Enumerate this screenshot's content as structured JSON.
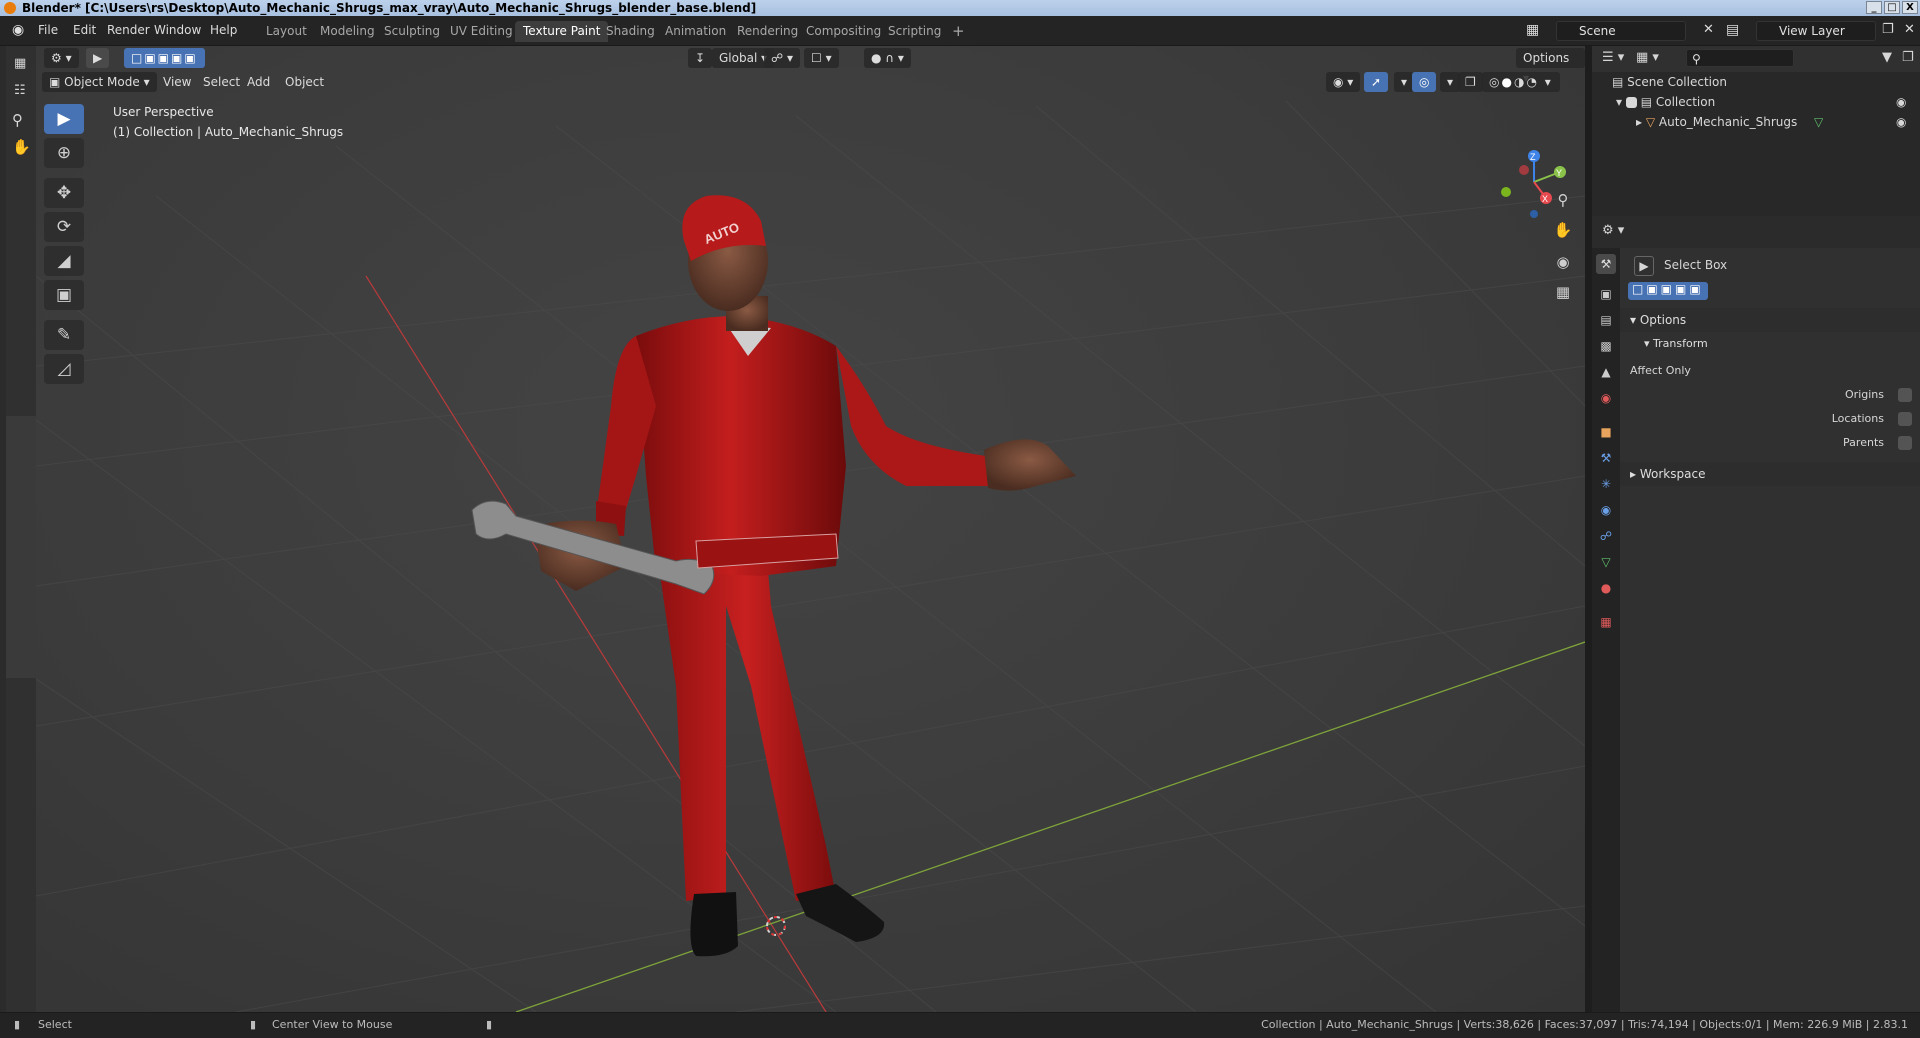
{
  "window": {
    "title": "Blender* [C:\\Users\\rs\\Desktop\\Auto_Mechanic_Shrugs_max_vray\\Auto_Mechanic_Shrugs_blender_base.blend]",
    "buttons": [
      "_",
      "□",
      "X"
    ]
  },
  "menu": [
    "File",
    "Edit",
    "Render",
    "Window",
    "Help"
  ],
  "workspaces": {
    "tabs": [
      "Layout",
      "Modeling",
      "Sculpting",
      "UV Editing",
      "Texture Paint",
      "Shading",
      "Animation",
      "Rendering",
      "Compositing",
      "Scripting"
    ],
    "active": "Texture Paint",
    "add": "+"
  },
  "scene": {
    "name": "Scene",
    "view_layer": "View Layer"
  },
  "viewport_header": {
    "mode": "Object Mode",
    "menus": [
      "View",
      "Select",
      "Add",
      "Object"
    ],
    "orientation": "Global",
    "options": "Options"
  },
  "viewport": {
    "perspective": "User Perspective",
    "collection_info": "(1) Collection | Auto_Mechanic_Shrugs",
    "cap_text": "AUTO",
    "gizmo_axes": [
      "Z",
      "Y",
      "X"
    ]
  },
  "outliner": {
    "root": "Scene Collection",
    "collection": "Collection",
    "object": "Auto_Mechanic_Shrugs"
  },
  "properties": {
    "tool_name": "Select Box",
    "options_label": "Options",
    "transform_label": "Transform",
    "affect_only": "Affect Only",
    "checkboxes": [
      {
        "label": "Origins",
        "checked": false
      },
      {
        "label": "Locations",
        "checked": false
      },
      {
        "label": "Parents",
        "checked": false
      }
    ],
    "workspace_label": "Workspace"
  },
  "statusbar": {
    "select": "Select",
    "center_view": "Center View to Mouse",
    "info": "Collection | Auto_Mechanic_Shrugs | Verts:38,626 | Faces:37,097 | Tris:74,194 | Objects:0/1 | Mem: 226.9 MiB | 2.83.1"
  },
  "colors": {
    "accent": "#4772b3",
    "axis_x": "#e6494e",
    "axis_y": "#8bc34a",
    "axis_z": "#3e84e8",
    "suit": "#b51818"
  }
}
